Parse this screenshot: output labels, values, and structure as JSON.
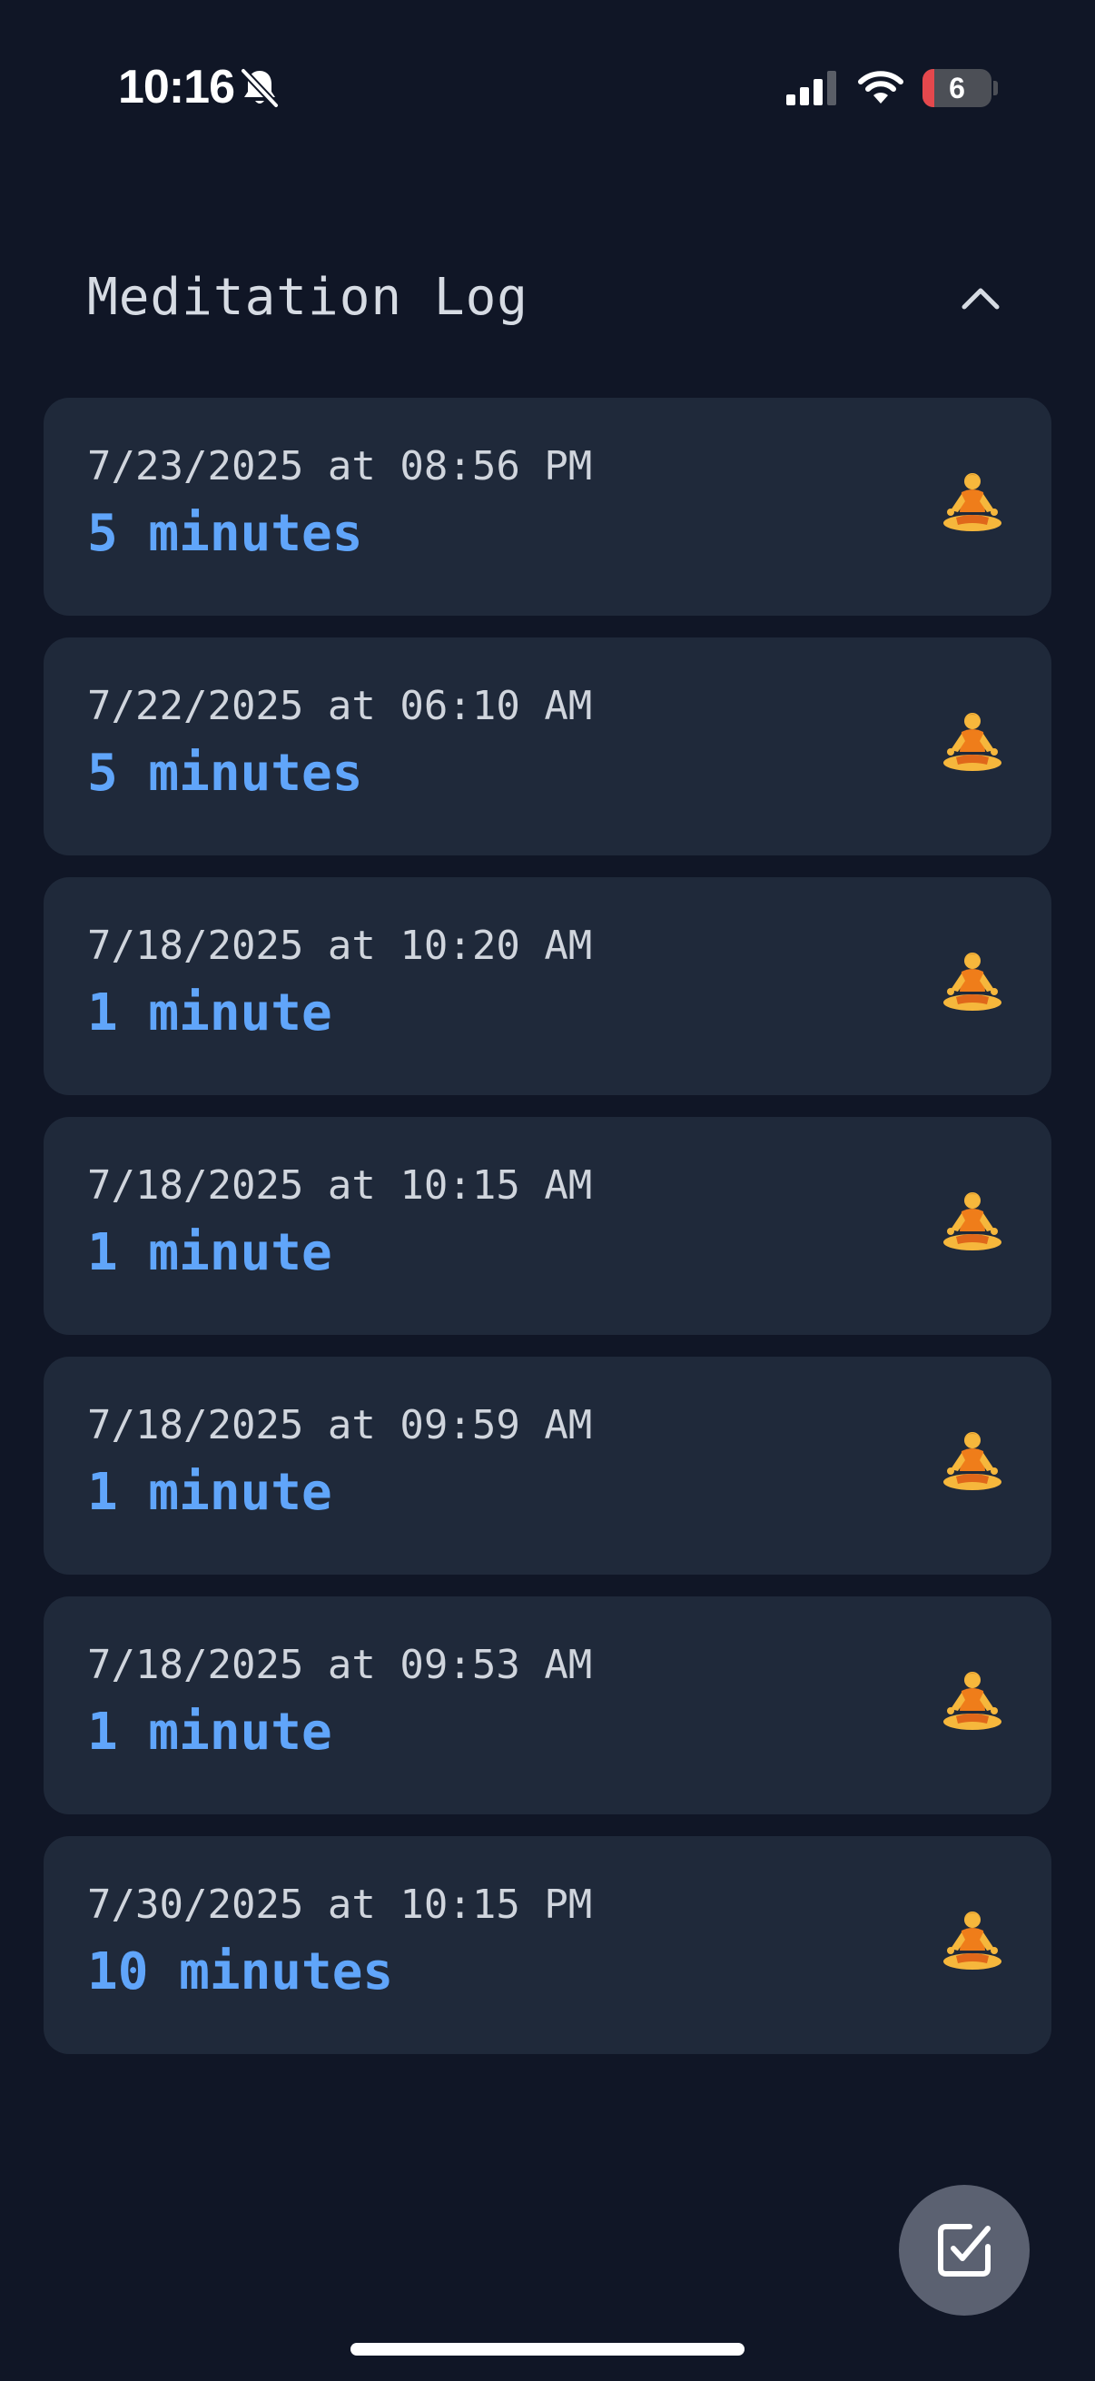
{
  "status_bar": {
    "time": "10:16",
    "battery_level": "6",
    "battery_percent": 6,
    "icons": [
      "bell-muted-icon",
      "cellular-signal-icon",
      "wifi-icon",
      "battery-icon"
    ]
  },
  "header": {
    "title": "Meditation Log",
    "collapse_icon": "chevron-up-icon"
  },
  "logs": [
    {
      "date": "7/23/2025 at 08:56 PM",
      "duration": "5 minutes",
      "icon": "meditation-icon"
    },
    {
      "date": "7/22/2025 at 06:10 AM",
      "duration": "5 minutes",
      "icon": "meditation-icon"
    },
    {
      "date": "7/18/2025 at 10:20 AM",
      "duration": "1 minute",
      "icon": "meditation-icon"
    },
    {
      "date": "7/18/2025 at 10:15 AM",
      "duration": "1 minute",
      "icon": "meditation-icon"
    },
    {
      "date": "7/18/2025 at 09:59 AM",
      "duration": "1 minute",
      "icon": "meditation-icon"
    },
    {
      "date": "7/18/2025 at 09:53 AM",
      "duration": "1 minute",
      "icon": "meditation-icon"
    },
    {
      "date": "7/30/2025 at 10:15 PM",
      "duration": "10 minutes",
      "icon": "meditation-icon"
    }
  ],
  "fab": {
    "icon": "checkbox-edit-icon"
  },
  "colors": {
    "background": "#101626",
    "card": "#1f293a",
    "duration_accent": "#60a5fa",
    "fab": "#5b6171",
    "battery_low": "#e5484d"
  }
}
